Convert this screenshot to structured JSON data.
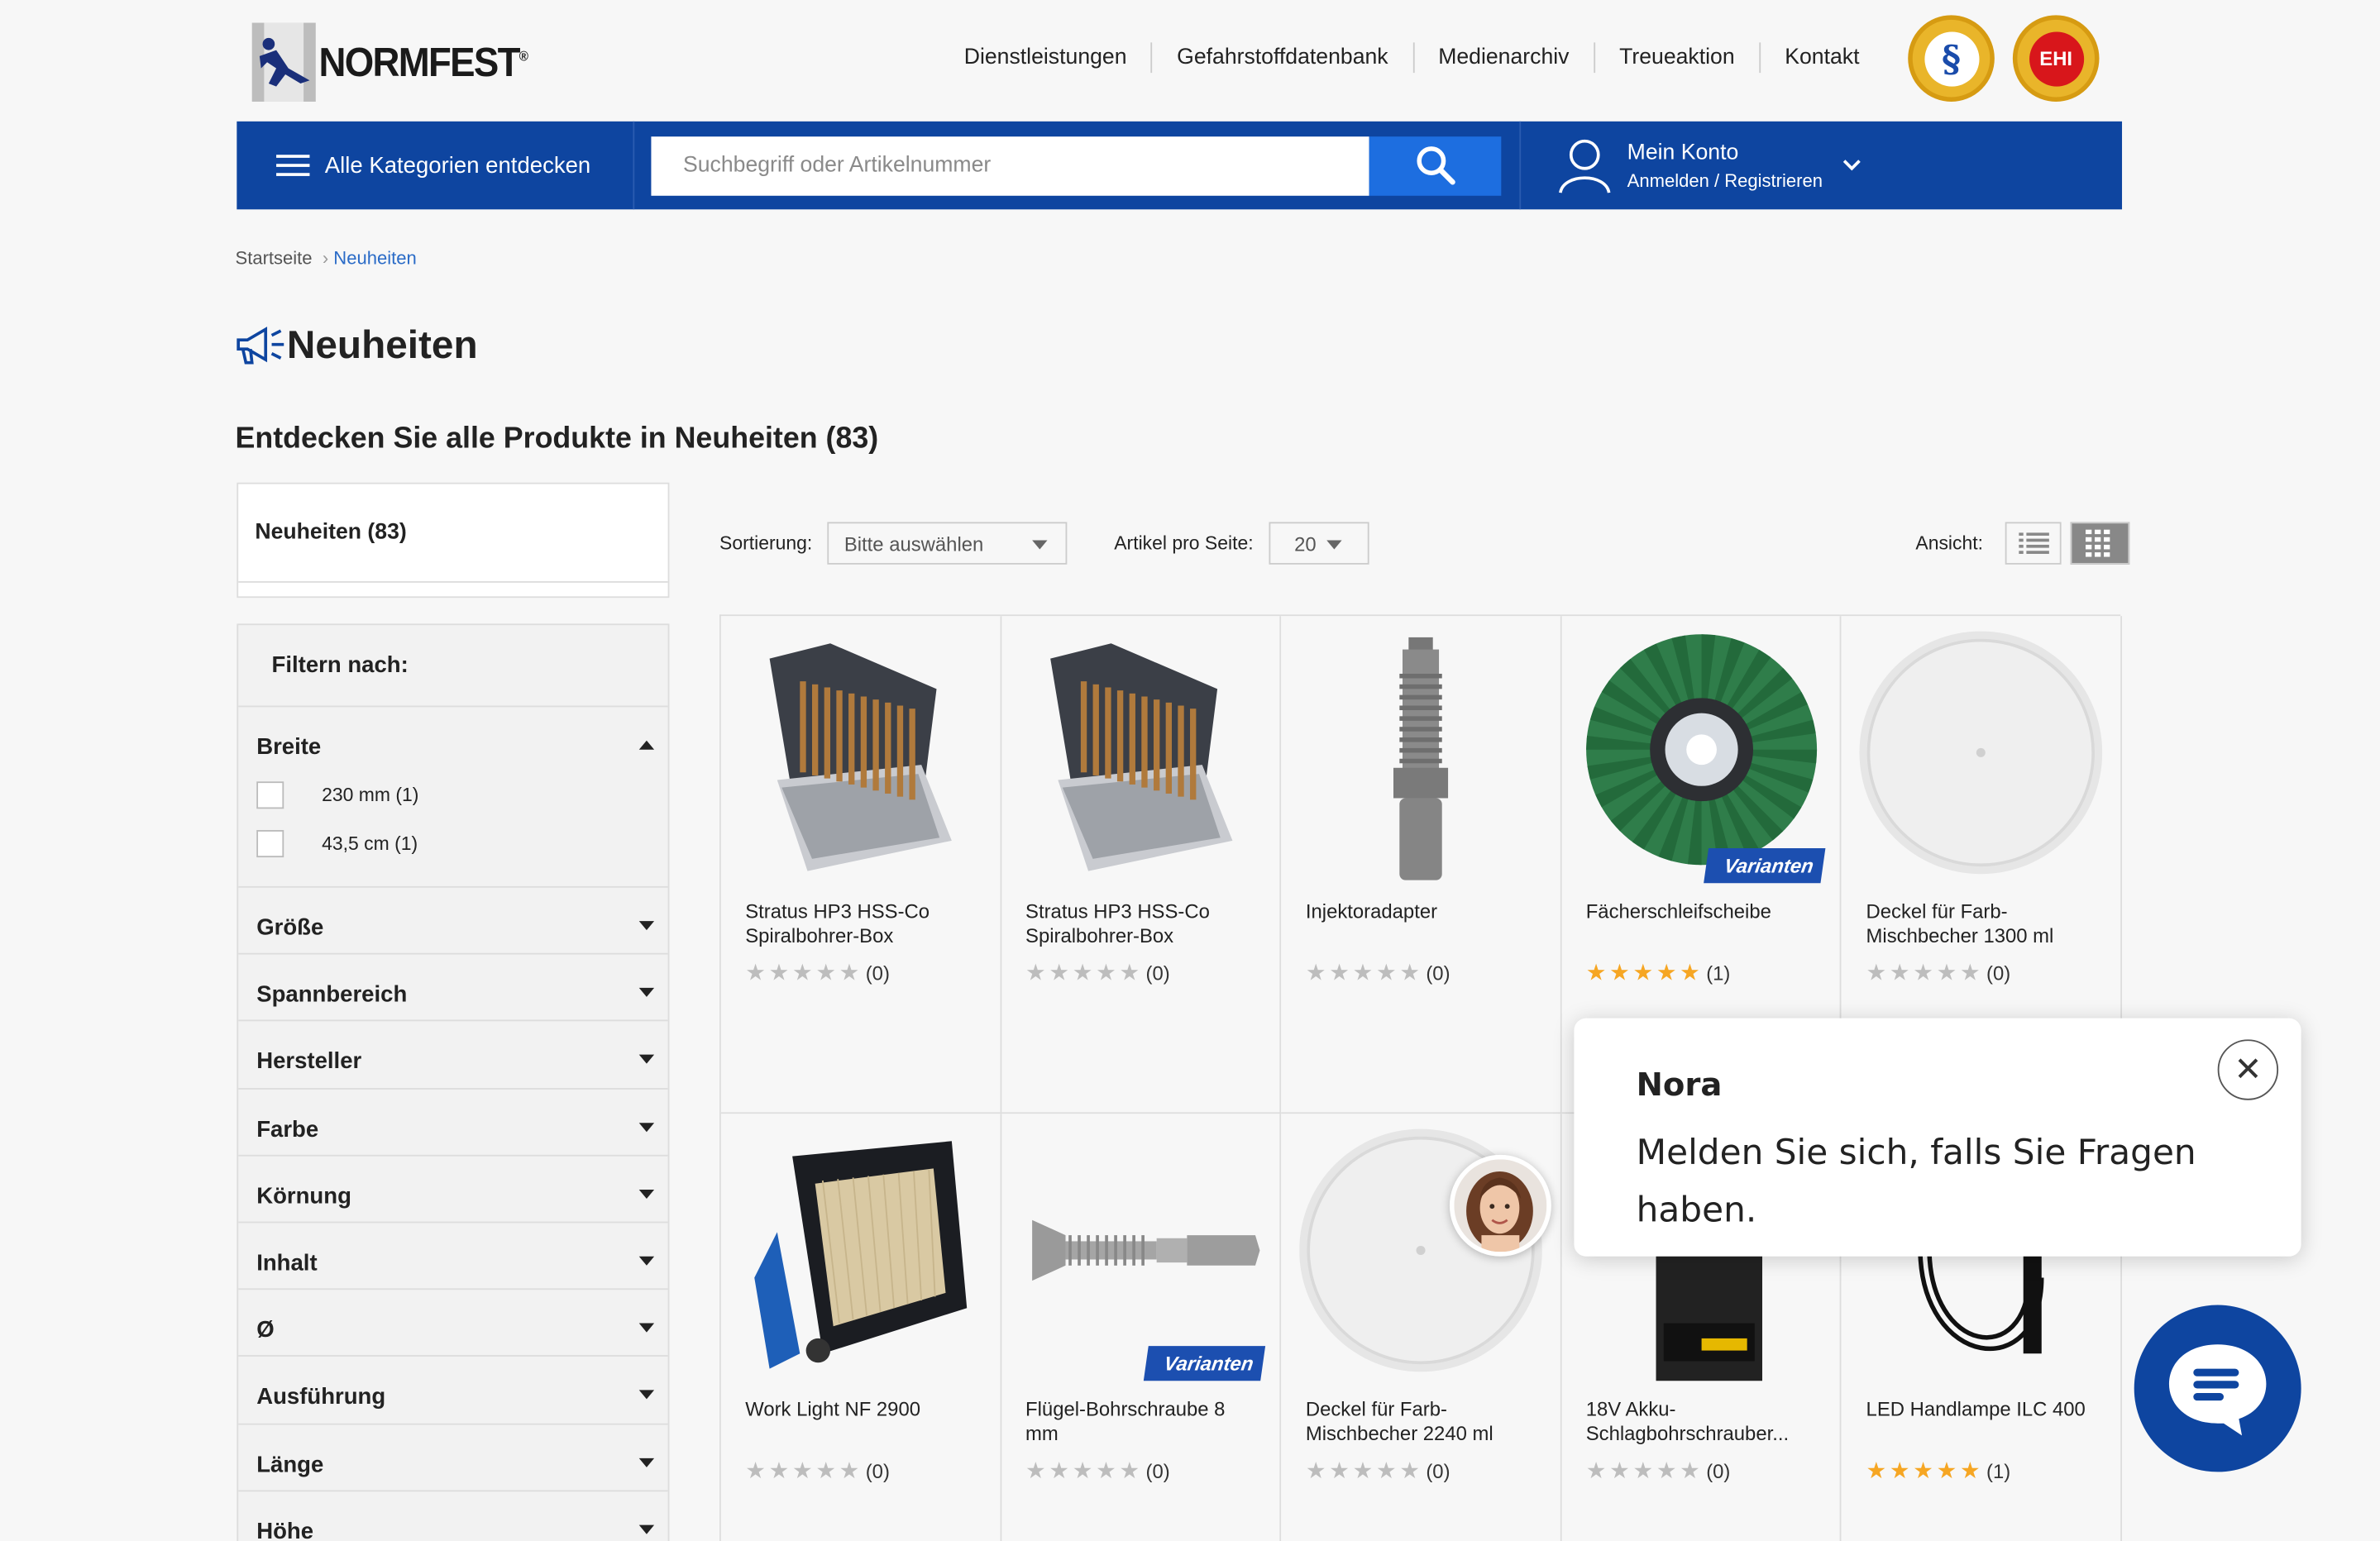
{
  "brand": {
    "name": "NORMFEST",
    "reg": "®"
  },
  "topnav": [
    "Dienstleistungen",
    "Gefahrstoffdatenbank",
    "Medienarchiv",
    "Treueaktion",
    "Kontakt"
  ],
  "seals": {
    "seal1_symbol": "§",
    "seal2_text": "EHI"
  },
  "bar": {
    "all_categories": "Alle Kategorien entdecken",
    "search_placeholder": "Suchbegriff oder Artikelnummer",
    "account_title": "Mein Konto",
    "account_sub": "Anmelden / Registrieren"
  },
  "breadcrumb": {
    "home": "Startseite",
    "current": "Neuheiten"
  },
  "page": {
    "title": "Neuheiten",
    "subtitle": "Entdecken Sie alle Produkte in Neuheiten (83)",
    "category_box": "Neuheiten (83)"
  },
  "filter": {
    "heading": "Filtern nach:",
    "open_section": {
      "label": "Breite",
      "options": [
        "230 mm (1)",
        "43,5 cm (1)"
      ]
    },
    "sections": [
      "Größe",
      "Spannbereich",
      "Hersteller",
      "Farbe",
      "Körnung",
      "Inhalt",
      "Ø",
      "Ausführung",
      "Länge",
      "Höhe"
    ]
  },
  "toolbar": {
    "sort_label": "Sortierung:",
    "sort_value": "Bitte auswählen",
    "perpage_label": "Artikel pro Seite:",
    "perpage_value": "20",
    "view_label": "Ansicht:"
  },
  "products": [
    {
      "name": "Stratus HP3 HSS-Co Spiralbohrer-Box",
      "rating": 0,
      "count": "(0)",
      "badge": "",
      "icon": "drill-bit-box"
    },
    {
      "name": "Stratus HP3 HSS-Co Spiralbohrer-Box",
      "rating": 0,
      "count": "(0)",
      "badge": "",
      "icon": "drill-bit-box"
    },
    {
      "name": "Injektoradapter",
      "rating": 0,
      "count": "(0)",
      "badge": "",
      "icon": "injector-adapter"
    },
    {
      "name": "Fächerschleifscheibe",
      "rating": 5,
      "count": "(1)",
      "badge": "Varianten",
      "icon": "flap-disc"
    },
    {
      "name": "Deckel für Farb-Mischbecher 1300 ml",
      "rating": 0,
      "count": "(0)",
      "badge": "",
      "icon": "lid"
    },
    {
      "name": "Work Light NF 2900",
      "rating": 0,
      "count": "(0)",
      "badge": "",
      "icon": "work-light"
    },
    {
      "name": "Flügel-Bohrschraube 8 mm",
      "rating": 0,
      "count": "(0)",
      "badge": "Varianten",
      "icon": "screw"
    },
    {
      "name": "Deckel für Farb-Mischbecher 2240 ml",
      "rating": 0,
      "count": "(0)",
      "badge": "",
      "icon": "lid"
    },
    {
      "name": "18V Akku-Schlagbohrschrauber...",
      "rating": 0,
      "count": "(0)",
      "badge": "",
      "icon": "impact-driver"
    },
    {
      "name": "LED Handlampe ILC 400",
      "rating": 5,
      "count": "(1)",
      "badge": "",
      "icon": "hand-lamp"
    }
  ],
  "chat": {
    "name": "Nora",
    "message": "Melden Sie sich, falls Sie Fragen haben.",
    "close": "✕"
  },
  "colors": {
    "primary": "#0e45a0",
    "search_button": "#1d6ee0",
    "star": "#f6a623",
    "link": "#2a6bc7"
  }
}
